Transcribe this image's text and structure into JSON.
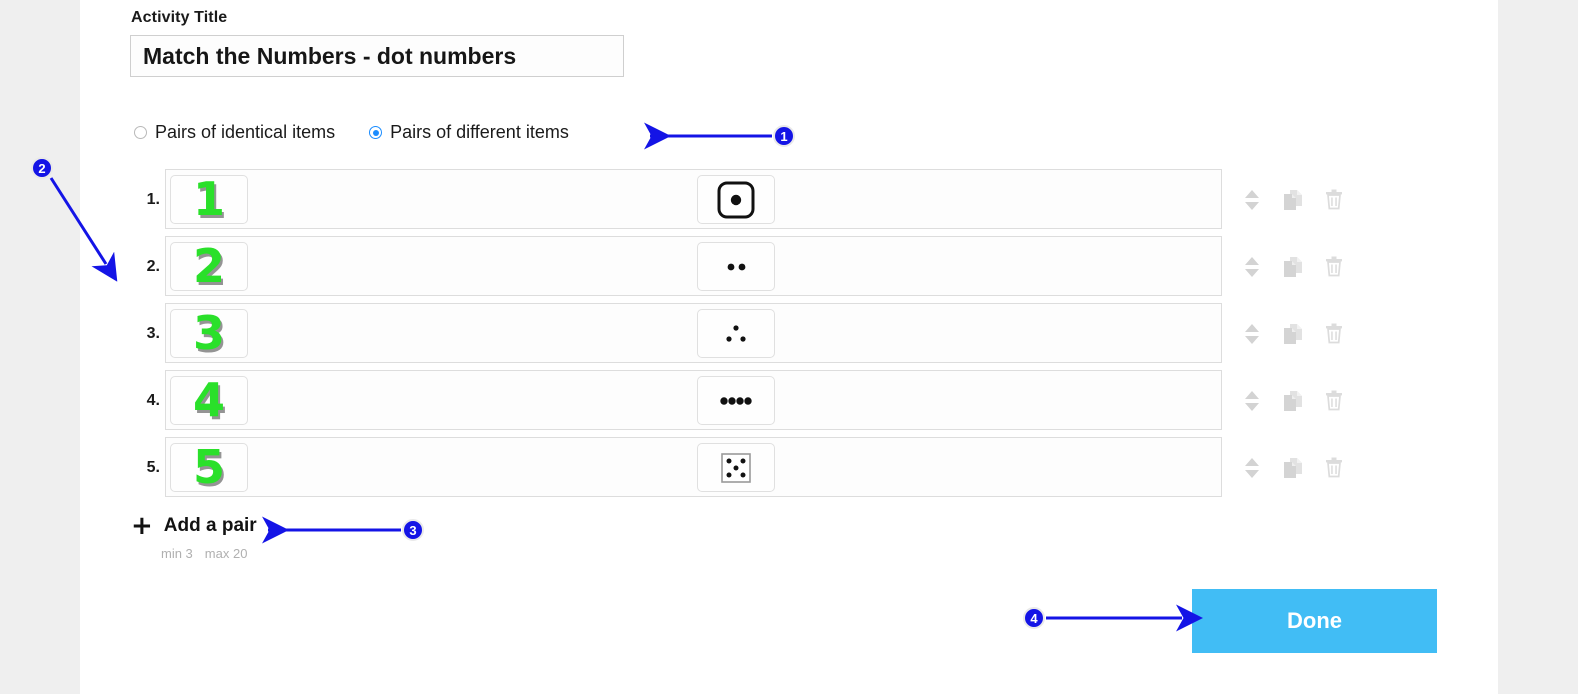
{
  "form": {
    "title_label": "Activity Title",
    "title_value": "Match the Numbers - dot numbers",
    "title_placeholder": "Activity Title"
  },
  "pair_mode": {
    "options": [
      {
        "label": "Pairs of identical items",
        "selected": false
      },
      {
        "label": "Pairs of different items",
        "selected": true
      }
    ]
  },
  "pairs": {
    "rows": [
      {
        "index": "1.",
        "left_text": "1",
        "right_kind": "die-face-1",
        "right_dots": 1
      },
      {
        "index": "2.",
        "left_text": "2",
        "right_kind": "dots-2",
        "right_dots": 2
      },
      {
        "index": "3.",
        "left_text": "3",
        "right_kind": "dots-3",
        "right_dots": 3
      },
      {
        "index": "4.",
        "left_text": "4",
        "right_kind": "dots-4",
        "right_dots": 4
      },
      {
        "index": "5.",
        "left_text": "5",
        "right_kind": "die-face-5",
        "right_dots": 5
      }
    ],
    "row_actions": {
      "reorder_title": "Reorder",
      "duplicate_title": "Duplicate",
      "delete_title": "Delete"
    }
  },
  "add_pair": {
    "plus": "+",
    "label": "Add a pair",
    "min_label": "min 3",
    "max_label": "max 20"
  },
  "footer": {
    "done_label": "Done"
  },
  "annotations": [
    {
      "id": "1",
      "label": "1"
    },
    {
      "id": "2",
      "label": "2"
    },
    {
      "id": "3",
      "label": "3"
    },
    {
      "id": "4",
      "label": "4"
    }
  ],
  "colors": {
    "accent_blue": "#41bdf5",
    "radio_blue": "#1a8cff",
    "number_green": "#2ae02a",
    "annotation_blue": "#1414e6",
    "page_background": "#efefef",
    "panel_background": "#ffffff"
  }
}
